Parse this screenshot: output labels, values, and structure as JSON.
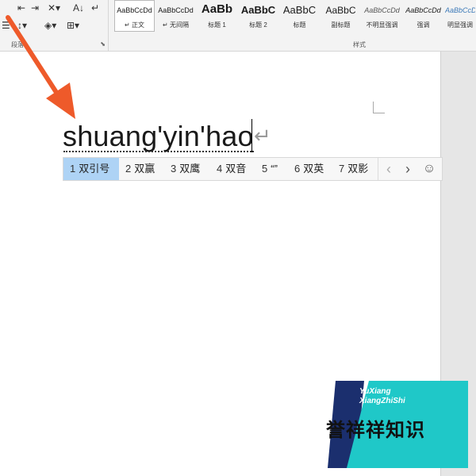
{
  "ribbon": {
    "paragraph_group_label": "段落",
    "styles_group_label": "样式",
    "styles": [
      {
        "preview": "AaBbCcDd",
        "name": "正文",
        "marker": "↵",
        "selected": true
      },
      {
        "preview": "AaBbCcDd",
        "name": "无间隔",
        "marker": "↵",
        "selected": false
      },
      {
        "preview": "AaBb",
        "name": "标题 1",
        "marker": "",
        "selected": false
      },
      {
        "preview": "AaBbC",
        "name": "标题 2",
        "marker": "",
        "selected": false
      },
      {
        "preview": "AaBbC",
        "name": "标题",
        "marker": "",
        "selected": false
      },
      {
        "preview": "AaBbC",
        "name": "副标题",
        "marker": "",
        "selected": false
      },
      {
        "preview": "AaBbCcDd",
        "name": "不明显强调",
        "marker": "",
        "selected": false
      },
      {
        "preview": "AaBbCcDd",
        "name": "强调",
        "marker": "",
        "selected": false
      },
      {
        "preview": "AaBbCcDd",
        "name": "明显强调",
        "marker": "",
        "selected": false
      }
    ]
  },
  "document": {
    "typed_text": "shuang'yin'hao",
    "paragraph_mark": "↵"
  },
  "ime": {
    "candidates": [
      {
        "num": "1",
        "text": "双引号",
        "selected": true
      },
      {
        "num": "2",
        "text": "双赢",
        "selected": false
      },
      {
        "num": "3",
        "text": "双鹰",
        "selected": false
      },
      {
        "num": "4",
        "text": "双音",
        "selected": false
      },
      {
        "num": "5",
        "text": "“”",
        "selected": false
      },
      {
        "num": "6",
        "text": "双英",
        "selected": false
      },
      {
        "num": "7",
        "text": "双影",
        "selected": false
      }
    ],
    "prev_label": "‹",
    "next_label": "›",
    "emoji_label": "☺"
  },
  "annotation": {
    "arrow_color": "#ee5a2a"
  },
  "watermark": {
    "line1": "YuXiang",
    "line2": "XiangZhiShi",
    "cn": "誉祥祥知识",
    "colors": {
      "dark": "#1b2f6e",
      "teal": "#1fc8c8"
    }
  }
}
